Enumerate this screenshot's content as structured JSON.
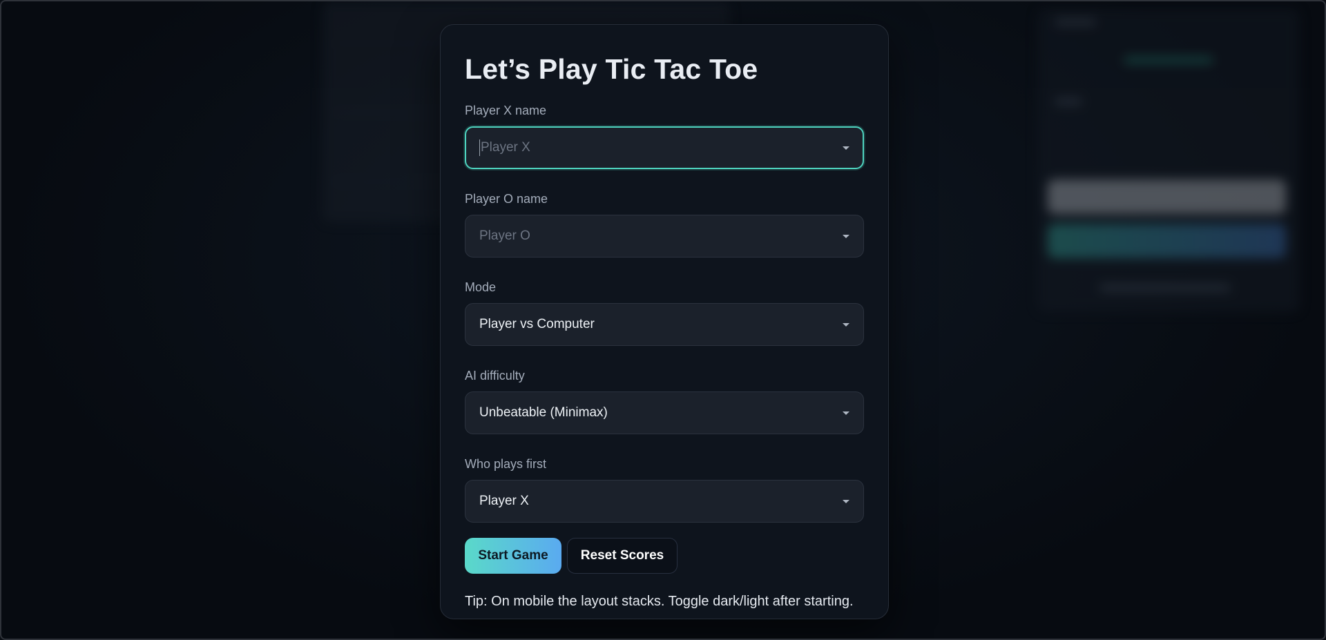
{
  "modal": {
    "title": "Let’s Play Tic Tac Toe",
    "fields": {
      "player_x": {
        "label": "Player X name",
        "value": "",
        "placeholder": "Player X"
      },
      "player_o": {
        "label": "Player O name",
        "value": "",
        "placeholder": "Player O"
      },
      "mode": {
        "label": "Mode",
        "value": "Player vs Computer"
      },
      "difficulty": {
        "label": "AI difficulty",
        "value": "Unbeatable (Minimax)"
      },
      "first": {
        "label": "Who plays first",
        "value": "Player X"
      }
    },
    "buttons": {
      "start": "Start Game",
      "reset": "Reset Scores"
    },
    "tip": "Tip: On mobile the layout stacks. Toggle dark/light after starting."
  },
  "icons": {
    "dropdown": "chevron-down-icon"
  },
  "colors": {
    "accent_start": "#5ad9c9",
    "accent_end": "#5aaaf0",
    "focus_ring": "#4ed3bf",
    "panel_bg": "#0e141d"
  }
}
